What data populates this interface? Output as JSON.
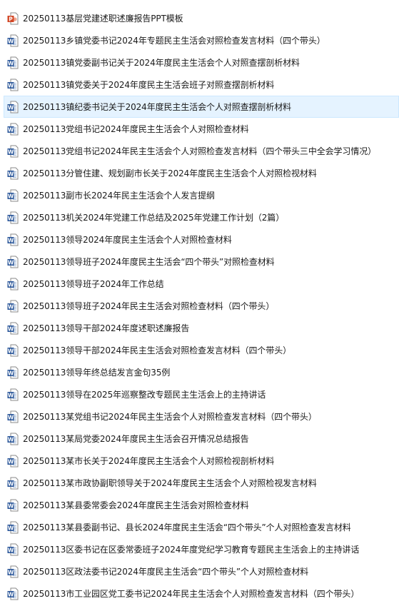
{
  "colors": {
    "selected_bg": "#e5f3ff",
    "selected_border": "#cce8ff",
    "word_blue": "#2b579a",
    "ppt_orange": "#d24726",
    "text": "#1a1a1a"
  },
  "files": [
    {
      "name": "20250113基层党建述职述廉报告PPT模板",
      "icon": "powerpoint-file-icon",
      "selected": false
    },
    {
      "name": "20250113乡镇党委书记2024年专题民主生活会对照检查发言材料（四个带头）",
      "icon": "word-file-icon",
      "selected": false
    },
    {
      "name": "20250113镇党委副书记关于2024年度民主生活会个人对照查摆剖析材料",
      "icon": "word-file-icon",
      "selected": false
    },
    {
      "name": "20250113镇党委关于2024年度民主生活会班子对照查摆剖析材料",
      "icon": "word-file-icon",
      "selected": false
    },
    {
      "name": "20250113镇纪委书记关于2024年度民主生活会个人对照查摆剖析材料",
      "icon": "word-file-icon",
      "selected": true
    },
    {
      "name": "20250113党组书记2024年度民主生活会个人对照检查材料",
      "icon": "word-file-icon",
      "selected": false
    },
    {
      "name": "20250113党组书记2024年民主生活会个人对照检查发言材料（四个带头三中全会学习情况）",
      "icon": "word-file-icon",
      "selected": false
    },
    {
      "name": "20250113分管住建、规划副市长关于2024年度民主生活会个人对照检视材料",
      "icon": "word-file-icon",
      "selected": false
    },
    {
      "name": "20250113副市长2024年民主生活会个人发言提纲",
      "icon": "word-file-icon",
      "selected": false
    },
    {
      "name": "20250113机关2024年党建工作总结及2025年党建工作计划（2篇）",
      "icon": "word-file-icon",
      "selected": false
    },
    {
      "name": "20250113领导2024年度民主生活会个人对照检查材料",
      "icon": "word-file-icon",
      "selected": false
    },
    {
      "name": "20250113领导班子2024年度民主生活会“四个带头”对照检查材料",
      "icon": "word-file-icon",
      "selected": false
    },
    {
      "name": "20250113领导班子2024年工作总结",
      "icon": "word-file-icon",
      "selected": false
    },
    {
      "name": "20250113领导班子2024年民主生活会对照检查材料（四个带头）",
      "icon": "word-file-icon",
      "selected": false
    },
    {
      "name": "20250113领导干部2024年度述职述廉报告",
      "icon": "word-file-icon",
      "selected": false
    },
    {
      "name": "20250113领导干部2024年民主生活会对照检查发言材料（四个带头）",
      "icon": "word-file-icon",
      "selected": false
    },
    {
      "name": "20250113领导年终总结发言金句35例",
      "icon": "word-file-icon",
      "selected": false
    },
    {
      "name": "20250113领导在2025年巡察整改专题民主生活会上的主持讲话",
      "icon": "word-file-icon",
      "selected": false
    },
    {
      "name": "20250113某党组书记2024年民主生活会个人对照检查发言材料（四个带头）",
      "icon": "word-file-icon",
      "selected": false
    },
    {
      "name": "20250113某局党委2024年度民主生活会召开情况总结报告",
      "icon": "word-file-icon",
      "selected": false
    },
    {
      "name": "20250113某市长关于2024年度民主生活会个人对照检视剖析材料",
      "icon": "word-file-icon",
      "selected": false
    },
    {
      "name": "20250113某市政协副职领导关于2024年度民主生活会个人对照检视发言材料",
      "icon": "word-file-icon",
      "selected": false
    },
    {
      "name": "20250113某县委常委会2024年度民主生活会对照检查材料",
      "icon": "word-file-icon",
      "selected": false
    },
    {
      "name": "20250113某县委副书记、县长2024年度民主生活会“四个带头”个人对照检查发言材料",
      "icon": "word-file-icon",
      "selected": false
    },
    {
      "name": "20250113区委书记在区委常委班子2024年度党纪学习教育专题民主生活会上的主持讲话",
      "icon": "word-file-icon",
      "selected": false
    },
    {
      "name": "20250113区政法委书记2024年度民主生活会“四个带头”个人对照检查材料",
      "icon": "word-file-icon",
      "selected": false
    },
    {
      "name": "20250113市工业园区党工委书记2024年民主生活会个人对照检查发言材料（四个带头）",
      "icon": "word-file-icon",
      "selected": false
    }
  ]
}
